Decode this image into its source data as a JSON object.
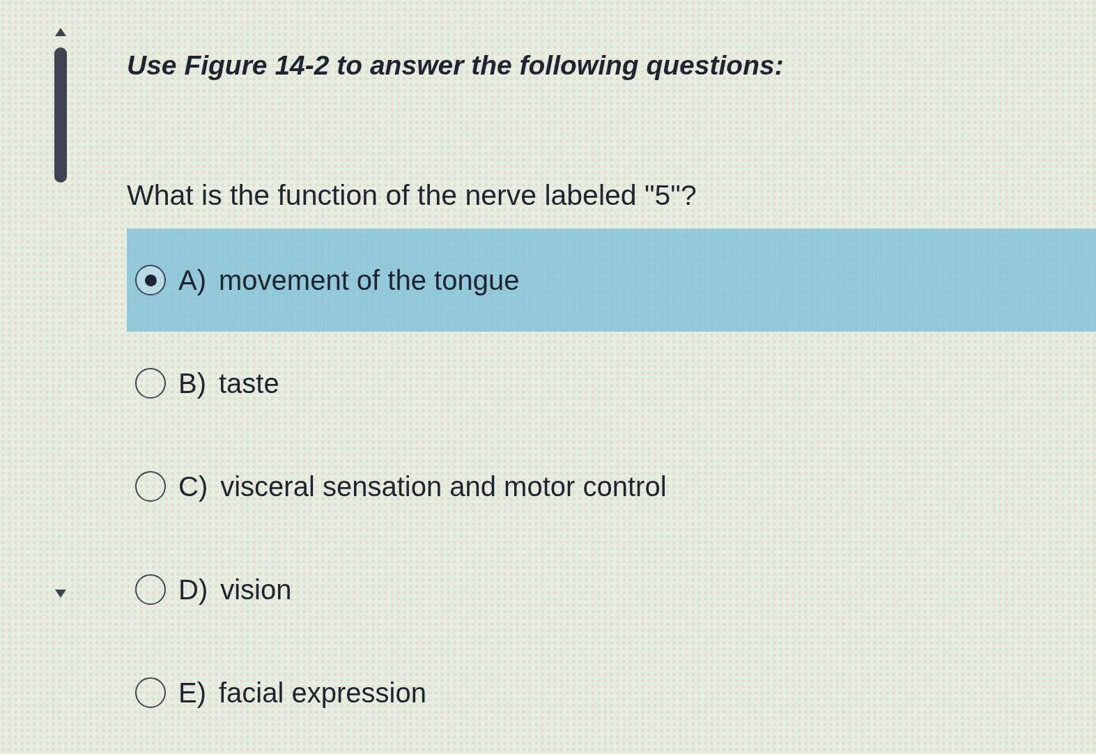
{
  "heading": "Use Figure 14-2 to answer the following questions:",
  "question": "What is the function of the nerve labeled \"5\"?",
  "options": [
    {
      "letter": "A)",
      "text": "movement of the tongue",
      "selected": true
    },
    {
      "letter": "B)",
      "text": "taste",
      "selected": false
    },
    {
      "letter": "C)",
      "text": "visceral sensation and motor control",
      "selected": false
    },
    {
      "letter": "D)",
      "text": "vision",
      "selected": false
    },
    {
      "letter": "E)",
      "text": "facial expression",
      "selected": false
    }
  ]
}
